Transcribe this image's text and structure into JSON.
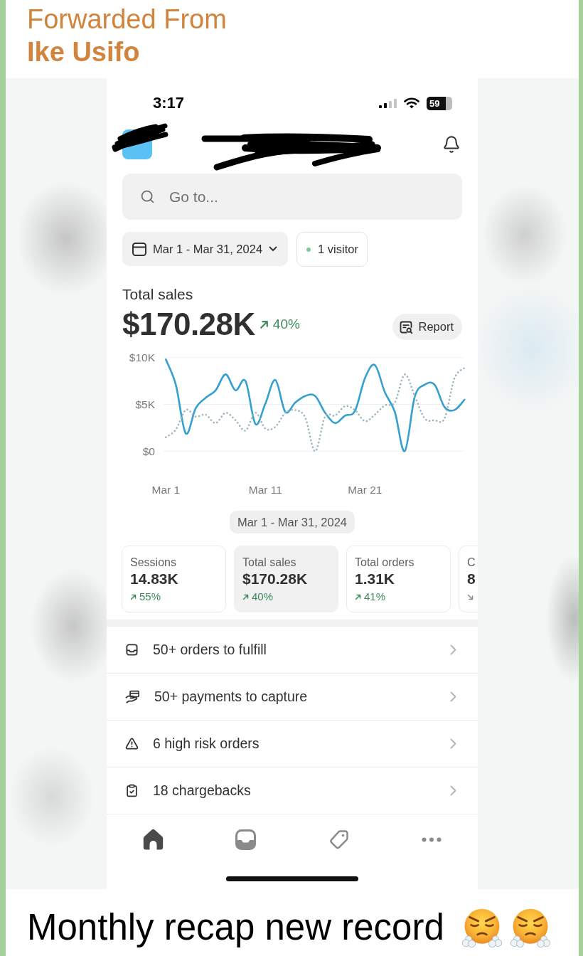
{
  "forwarded": {
    "label": "Forwarded From",
    "sender": "Ike Usifo"
  },
  "screenshot": {
    "status_bar": {
      "time": "3:17",
      "battery": "59"
    },
    "search": {
      "placeholder": "Go to..."
    },
    "date_range": "Mar 1 - Mar 31, 2024",
    "visitors": "1 visitor",
    "total_sales": {
      "label": "Total sales",
      "value": "$170.28K",
      "change": "40%",
      "increase": true
    },
    "report_button": "Report",
    "chart": {
      "chart_data": {
        "type": "line",
        "categories": [
          "Mar 1",
          null,
          null,
          null,
          null,
          null,
          null,
          null,
          null,
          null,
          "Mar 11",
          null,
          null,
          null,
          null,
          null,
          null,
          null,
          null,
          null,
          "Mar 21",
          null,
          null,
          null,
          null,
          null,
          null,
          null,
          null,
          null,
          null
        ],
        "ylim": [
          0,
          10000
        ],
        "yticks": [
          {
            "value": 0,
            "label": "$0"
          },
          {
            "value": 5000,
            "label": "$5K"
          },
          {
            "value": 10000,
            "label": "$10K"
          }
        ],
        "series": [
          {
            "color": "#34a0d0",
            "line_style": "solid",
            "values": [
              9800,
              7100,
              1900,
              4600,
              5700,
              6500,
              8200,
              6500,
              7500,
              2900,
              5100,
              7600,
              4200,
              5200,
              5900,
              5900,
              4100,
              3000,
              3800,
              4300,
              7800,
              9200,
              6300,
              4200,
              0,
              5800,
              7100,
              7100,
              4700,
              4400,
              5500
            ]
          },
          {
            "color": "#9ab6bf",
            "line_style": "dotted",
            "values": [
              1500,
              2300,
              4400,
              3700,
              3900,
              3000,
              4100,
              3300,
              2200,
              4100,
              2400,
              2600,
              4100,
              4400,
              3600,
              0,
              3700,
              3800,
              4800,
              4400,
              3200,
              3900,
              4900,
              5200,
              8200,
              5900,
              3500,
              3300,
              3500,
              7800,
              8900
            ]
          }
        ]
      }
    },
    "chart_range": "Mar 1 - Mar 31, 2024",
    "metrics": [
      {
        "label": "Sessions",
        "value": "14.83K",
        "change": "55%",
        "increase": true,
        "selected": false
      },
      {
        "label": "Total sales",
        "value": "$170.28K",
        "change": "40%",
        "increase": true,
        "selected": true
      },
      {
        "label": "Total orders",
        "value": "1.31K",
        "change": "41%",
        "increase": true,
        "selected": false
      },
      {
        "label": "C",
        "value": "8",
        "increase": false,
        "selected": false
      }
    ],
    "tasks": [
      {
        "label": "50+ orders to fulfill"
      },
      {
        "label": "50+ payments to capture"
      },
      {
        "label": "6 high risk orders"
      },
      {
        "label": "18 chargebacks"
      }
    ],
    "nav": [
      {
        "selected": true
      },
      {
        "selected": false
      },
      {
        "selected": false
      },
      {
        "selected": false
      }
    ]
  },
  "caption": {
    "text": "Monthly recap new record",
    "emojis": [
      {
        "kind": "face-with-steam"
      },
      {
        "kind": "face-with-steam"
      }
    ]
  }
}
